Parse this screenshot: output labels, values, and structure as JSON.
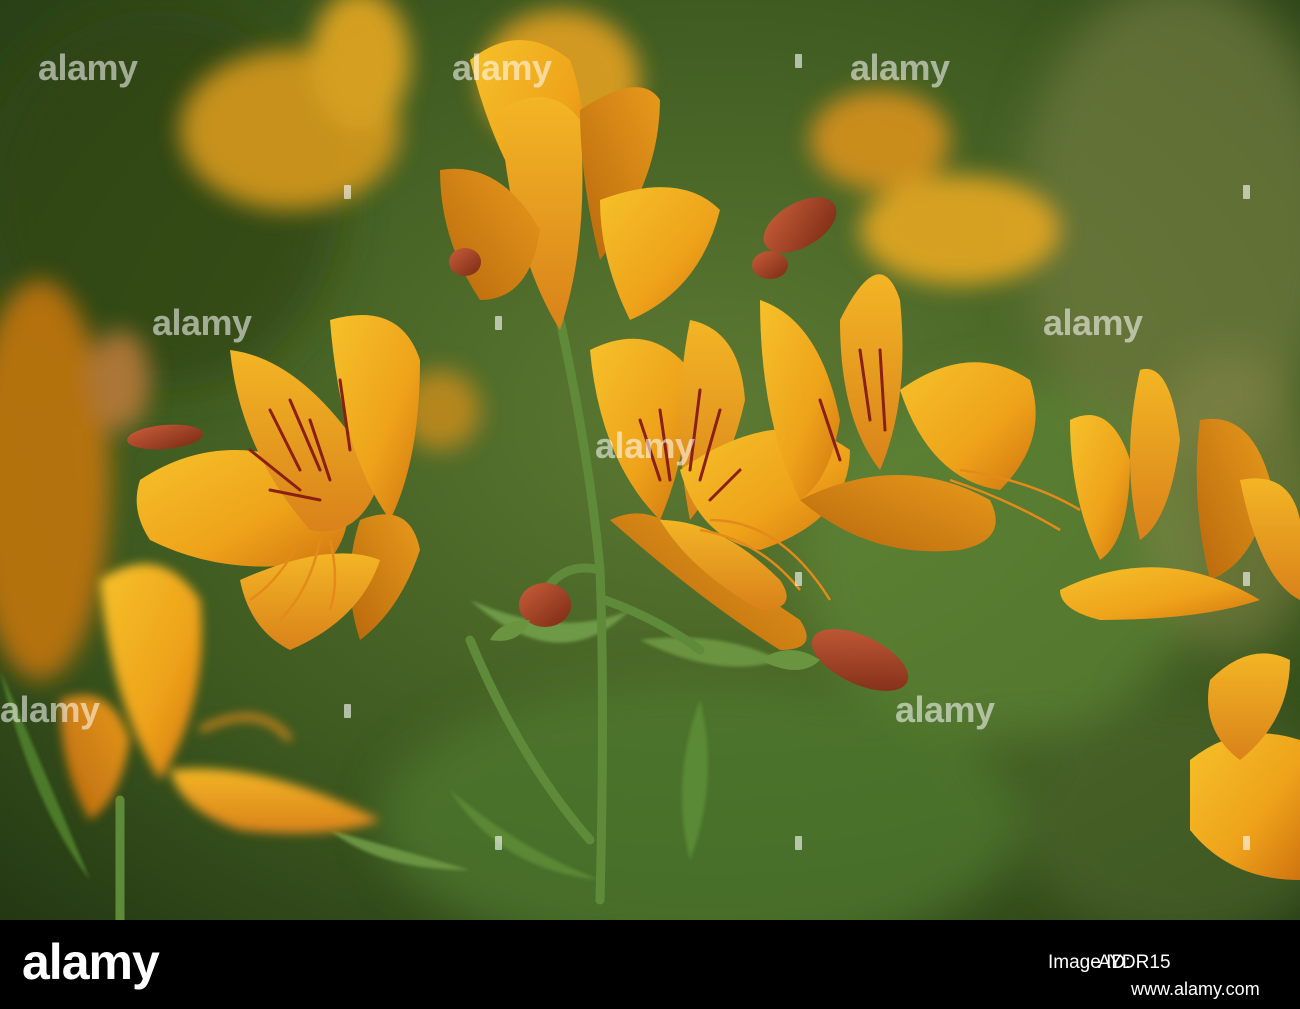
{
  "photo": {
    "subject": "flowers-photo",
    "palette": {
      "background_dark": "#1f3411",
      "background_mid": "#4d6a2a",
      "petal_yellow": "#f0b41a",
      "petal_orange": "#e6891a",
      "petal_shadow": "#b86a0a",
      "stripe_red": "#8a1f12",
      "leaf_green": "#5f8a3a",
      "bud_red": "#a8402a"
    }
  },
  "watermark": {
    "text": "alamy"
  },
  "footer": {
    "logo": "alamy",
    "image_id_label": "Image ID:",
    "image_id": "AYDR15",
    "url": "www.alamy.com"
  }
}
